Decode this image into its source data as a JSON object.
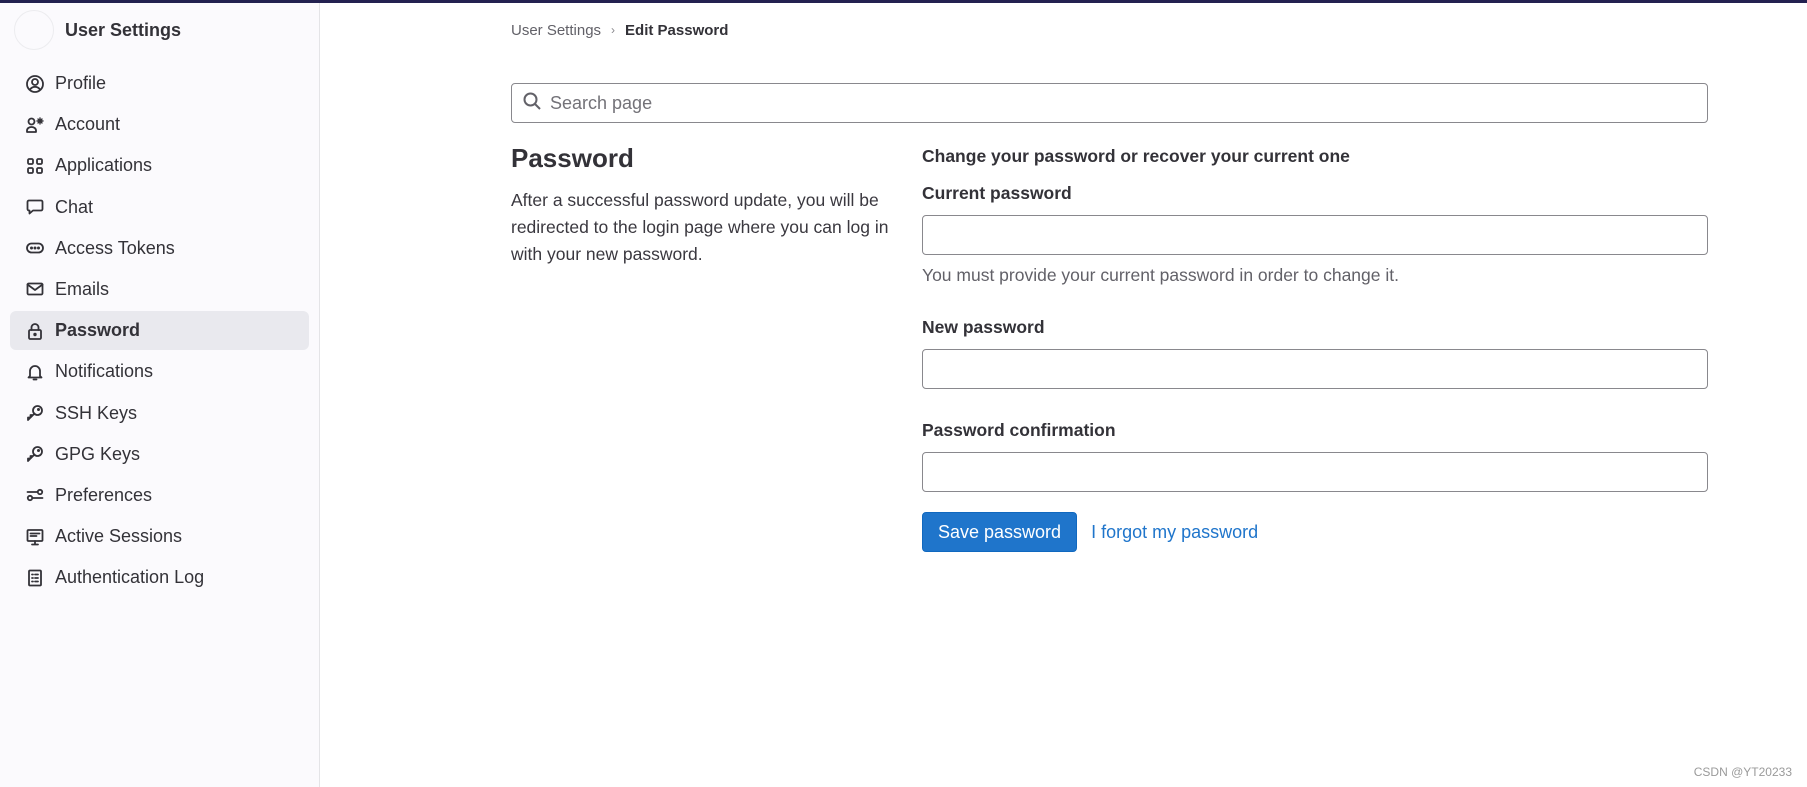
{
  "topbar": {
    "color": "#232150"
  },
  "sidebar": {
    "title": "User Settings",
    "items": [
      {
        "label": "Profile",
        "icon": "profile-icon",
        "active": false
      },
      {
        "label": "Account",
        "icon": "account-icon",
        "active": false
      },
      {
        "label": "Applications",
        "icon": "applications-icon",
        "active": false
      },
      {
        "label": "Chat",
        "icon": "chat-icon",
        "active": false
      },
      {
        "label": "Access Tokens",
        "icon": "token-icon",
        "active": false
      },
      {
        "label": "Emails",
        "icon": "mail-icon",
        "active": false
      },
      {
        "label": "Password",
        "icon": "lock-icon",
        "active": true
      },
      {
        "label": "Notifications",
        "icon": "bell-icon",
        "active": false
      },
      {
        "label": "SSH Keys",
        "icon": "key-icon",
        "active": false
      },
      {
        "label": "GPG Keys",
        "icon": "key-icon",
        "active": false
      },
      {
        "label": "Preferences",
        "icon": "preferences-icon",
        "active": false
      },
      {
        "label": "Active Sessions",
        "icon": "monitor-icon",
        "active": false
      },
      {
        "label": "Authentication Log",
        "icon": "log-icon",
        "active": false
      }
    ]
  },
  "breadcrumb": {
    "parent": "User Settings",
    "separator": "›",
    "current": "Edit Password"
  },
  "search": {
    "placeholder": "Search page",
    "value": ""
  },
  "section": {
    "title": "Password",
    "description": "After a successful password update, you will be redirected to the login page where you can log in with your new password."
  },
  "form": {
    "subheading": "Change your password or recover your current one",
    "current_password": {
      "label": "Current password",
      "value": "",
      "help": "You must provide your current password in order to change it."
    },
    "new_password": {
      "label": "New password",
      "value": ""
    },
    "password_confirmation": {
      "label": "Password confirmation",
      "value": ""
    },
    "save_label": "Save password",
    "forgot_label": "I forgot my password"
  },
  "colors": {
    "primary": "#1f75cb",
    "active_item_bg": "#e9e9ee",
    "sidebar_bg": "#fbfafd"
  },
  "watermark": "CSDN @YT20233"
}
